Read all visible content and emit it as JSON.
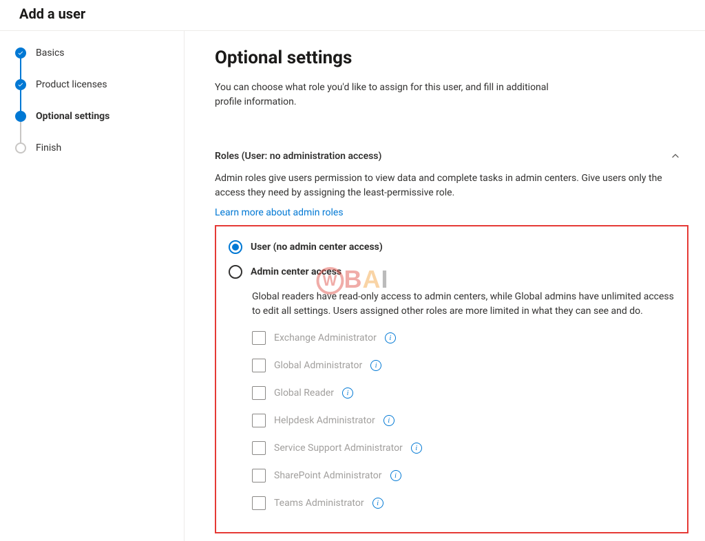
{
  "header": {
    "title": "Add a user"
  },
  "steps": [
    {
      "label": "Basics",
      "state": "done"
    },
    {
      "label": "Product licenses",
      "state": "done"
    },
    {
      "label": "Optional settings",
      "state": "current"
    },
    {
      "label": "Finish",
      "state": "pending"
    }
  ],
  "main": {
    "title": "Optional settings",
    "subtitle": "You can choose what role you'd like to assign for this user, and fill in additional profile information."
  },
  "roles_section": {
    "header": "Roles (User: no administration access)",
    "description": "Admin roles give users permission to view data and complete tasks in admin centers. Give users only the access they need by assigning the least-permissive role.",
    "link": "Learn more about admin roles",
    "radio_user": "User (no admin center access)",
    "radio_admin": "Admin center access",
    "admin_desc": "Global readers have read-only access to admin centers, while Global admins have unlimited access to edit all settings. Users assigned other roles are more limited in what they can see and do.",
    "roles": [
      "Exchange Administrator",
      "Global Administrator",
      "Global Reader",
      "Helpdesk Administrator",
      "Service Support Administrator",
      "SharePoint Administrator",
      "Teams Administrator"
    ]
  },
  "watermark": {
    "b": "B",
    "a": "A",
    "i": "I"
  }
}
